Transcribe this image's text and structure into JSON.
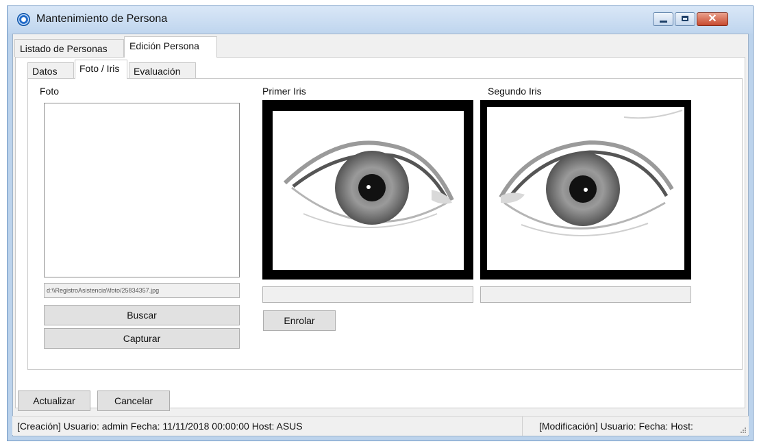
{
  "window": {
    "title": "Mantenimiento de Persona"
  },
  "outer_tabs": [
    {
      "label": "Listado de Personas",
      "active": false
    },
    {
      "label": "Edición Persona",
      "active": true
    }
  ],
  "inner_tabs": [
    {
      "label": "Datos",
      "active": false
    },
    {
      "label": "Foto / Iris",
      "active": true
    },
    {
      "label": "Evaluación",
      "active": false
    }
  ],
  "photo": {
    "label": "Foto",
    "path": "d:\\\\RegistroAsistencia\\\\foto/25834357.jpg",
    "buscar_label": "Buscar",
    "capturar_label": "Capturar"
  },
  "iris": {
    "first_label": "Primer Iris",
    "second_label": "Segundo Iris",
    "enrolar_label": "Enrolar"
  },
  "actions": {
    "actualizar_label": "Actualizar",
    "cancelar_label": "Cancelar"
  },
  "status": {
    "creation": "[Creación] Usuario: admin Fecha: 11/11/2018 00:00:00 Host: ASUS",
    "modification": "[Modificación] Usuario:  Fecha:  Host:"
  }
}
